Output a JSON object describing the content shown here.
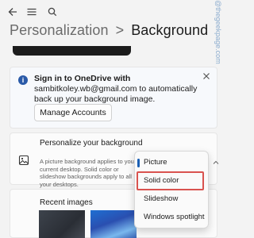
{
  "header": {
    "breadcrumb_parent": "Personalization",
    "breadcrumb_separator": ">",
    "breadcrumb_current": "Background"
  },
  "onedrive_banner": {
    "title": "Sign in to OneDrive with",
    "body": "sambitkoley.wb@gmail.com to automatically back up your background image.",
    "button_label": "Manage Accounts",
    "info_glyph": "i"
  },
  "personalize": {
    "title": "Personalize your background",
    "description": "A picture background applies to your current desktop. Solid color or slideshow backgrounds apply to all your desktops."
  },
  "background_type_menu": {
    "options": [
      "Picture",
      "Solid color",
      "Slideshow",
      "Windows spotlight"
    ],
    "selected": "Picture",
    "highlighted": "Solid color"
  },
  "recent_images": {
    "title": "Recent images"
  },
  "watermark": "@thegeekpage.com",
  "icons": [
    "back-arrow-icon",
    "hamburger-menu-icon",
    "search-icon",
    "info-icon",
    "close-icon",
    "picture-icon",
    "chevron-up-icon"
  ],
  "colors": {
    "accent": "#1a5fb4",
    "highlight_border": "#d9534f",
    "info_badge": "#2a5aa8"
  }
}
